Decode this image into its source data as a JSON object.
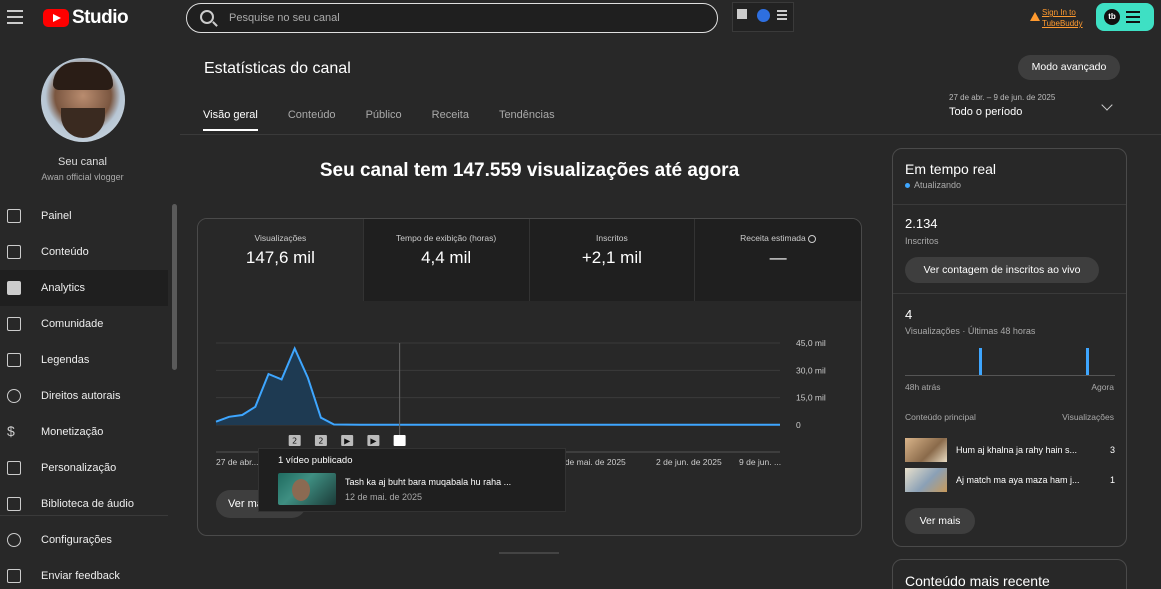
{
  "topbar": {
    "logo_text": "Studio",
    "search_placeholder": "Pesquise no seu canal",
    "tubebuddy_line1": "Sign In to",
    "tubebuddy_line2": "TubeBuddy",
    "tubebuddy_badge": "tb"
  },
  "sidebar": {
    "channel_label": "Seu canal",
    "channel_name": "Awan official vlogger",
    "items": [
      {
        "label": "Painel"
      },
      {
        "label": "Conteúdo"
      },
      {
        "label": "Analytics"
      },
      {
        "label": "Comunidade"
      },
      {
        "label": "Legendas"
      },
      {
        "label": "Direitos autorais"
      },
      {
        "label": "Monetização"
      },
      {
        "label": "Personalização"
      },
      {
        "label": "Biblioteca de áudio"
      }
    ],
    "bottom_items": [
      {
        "label": "Configurações"
      },
      {
        "label": "Enviar feedback"
      }
    ]
  },
  "header": {
    "title": "Estatísticas do canal",
    "advanced_button": "Modo avançado",
    "tabs": [
      "Visão geral",
      "Conteúdo",
      "Público",
      "Receita",
      "Tendências"
    ],
    "period_range": "27 de abr. – 9 de jun. de 2025",
    "period_value": "Todo o período"
  },
  "main": {
    "headline": "Seu canal tem 147.559 visualizações até agora",
    "metrics": [
      {
        "label": "Visualizações",
        "value": "147,6 mil"
      },
      {
        "label": "Tempo de exibição (horas)",
        "value": "4,4 mil"
      },
      {
        "label": "Inscritos",
        "value": "+2,1 mil"
      },
      {
        "label": "Receita estimada",
        "value": "—"
      }
    ],
    "see_more": "Ver mais",
    "tooltip": {
      "title": "1 vídeo publicado",
      "video_title": "Tash ka aj buht bara muqabala hu raha ...",
      "video_date": "12 de mai. de 2025"
    }
  },
  "chart_data": {
    "type": "area",
    "x_tick_labels": [
      "27 de abr...",
      "26 de mai. de 2025",
      "2 de jun. de 2025",
      "9 de jun. ..."
    ],
    "y_tick_labels": [
      "45,0 mil",
      "30,0 mil",
      "15,0 mil",
      "0"
    ],
    "ylim": [
      0,
      45000
    ],
    "series": [
      {
        "values": [
          1800,
          4500,
          5500,
          10000,
          28000,
          25000,
          42000,
          26000,
          4000,
          300,
          200,
          150,
          100,
          100,
          100,
          100,
          100,
          100,
          100,
          100,
          100,
          100,
          100,
          100,
          100,
          100,
          100,
          100,
          100,
          100,
          100,
          100,
          100,
          100,
          100,
          100,
          100,
          100,
          100,
          100,
          100,
          100,
          100,
          100
        ]
      }
    ],
    "markers": [
      "2",
      "2",
      "▶",
      "▶",
      ""
    ],
    "colors": {
      "line": "#3ea6ff",
      "fill": "#1e3a52"
    }
  },
  "realtime": {
    "title": "Em tempo real",
    "status": "Atualizando",
    "subs_value": "2.134",
    "subs_label": "Inscritos",
    "live_button": "Ver contagem de inscritos ao vivo",
    "views_value": "4",
    "views_label": "Visualizações · Últimas 48 horas",
    "axis_left": "48h atrás",
    "axis_right": "Agora",
    "top_content_label": "Conteúdo principal",
    "top_views_label": "Visualizações",
    "videos": [
      {
        "title": "Hum aj khalna ja rahy hain s...",
        "views": "3"
      },
      {
        "title": "Aj match ma aya maza ham j...",
        "views": "1"
      }
    ],
    "more_button": "Ver mais",
    "mini_bars": [
      {
        "pos": 0.35,
        "value": 1
      },
      {
        "pos": 0.86,
        "value": 1
      }
    ]
  },
  "latest": {
    "title": "Conteúdo mais recente"
  }
}
